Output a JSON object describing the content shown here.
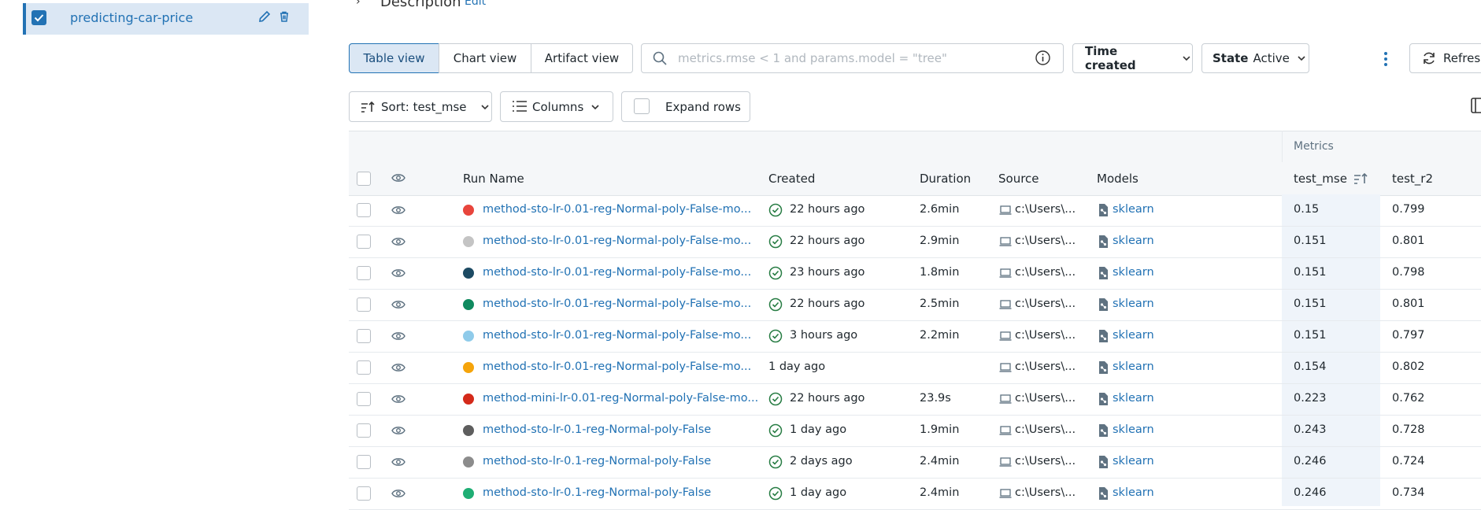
{
  "sidebar": {
    "experiment_name": "predicting-car-price"
  },
  "description": {
    "title": "Description",
    "edit_label": "Edit"
  },
  "view_tabs": [
    "Table view",
    "Chart view",
    "Artifact view"
  ],
  "search": {
    "placeholder": "metrics.rmse < 1 and params.model = \"tree\""
  },
  "time_filter": {
    "label": "Time created"
  },
  "state_filter": {
    "label": "State",
    "value": "Active"
  },
  "refresh_label": "Refresh",
  "sort_label": "Sort: test_mse",
  "columns_label": "Columns",
  "expand_rows_label": "Expand rows",
  "table": {
    "group_header": "Metrics",
    "headers": {
      "run_name": "Run Name",
      "created": "Created",
      "duration": "Duration",
      "source": "Source",
      "models": "Models",
      "metric1": "test_mse",
      "metric2": "test_r2"
    },
    "rows": [
      {
        "color": "#e8453c",
        "run_name": "method-sto-lr-0.01-reg-Normal-poly-False-mo...",
        "status": "finished",
        "created": "22 hours ago",
        "duration": "2.6min",
        "source": "c:\\Users\\...",
        "model": "sklearn",
        "test_mse": "0.15",
        "test_r2": "0.799"
      },
      {
        "color": "#c4c4c4",
        "run_name": "method-sto-lr-0.01-reg-Normal-poly-False-mo...",
        "status": "finished",
        "created": "22 hours ago",
        "duration": "2.9min",
        "source": "c:\\Users\\...",
        "model": "sklearn",
        "test_mse": "0.151",
        "test_r2": "0.801"
      },
      {
        "color": "#1c4a63",
        "run_name": "method-sto-lr-0.01-reg-Normal-poly-False-mo...",
        "status": "finished",
        "created": "23 hours ago",
        "duration": "1.8min",
        "source": "c:\\Users\\...",
        "model": "sklearn",
        "test_mse": "0.151",
        "test_r2": "0.798"
      },
      {
        "color": "#0f8a5f",
        "run_name": "method-sto-lr-0.01-reg-Normal-poly-False-mo...",
        "status": "finished",
        "created": "22 hours ago",
        "duration": "2.5min",
        "source": "c:\\Users\\...",
        "model": "sklearn",
        "test_mse": "0.151",
        "test_r2": "0.801"
      },
      {
        "color": "#8fcbea",
        "run_name": "method-sto-lr-0.01-reg-Normal-poly-False-mo...",
        "status": "finished",
        "created": "3 hours ago",
        "duration": "2.2min",
        "source": "c:\\Users\\...",
        "model": "sklearn",
        "test_mse": "0.151",
        "test_r2": "0.797"
      },
      {
        "color": "#f5a40b",
        "run_name": "method-sto-lr-0.01-reg-Normal-poly-False-mo...",
        "status": "none",
        "created": "1 day ago",
        "duration": "",
        "source": "c:\\Users\\...",
        "model": "sklearn",
        "test_mse": "0.154",
        "test_r2": "0.802"
      },
      {
        "color": "#d42a1a",
        "run_name": "method-mini-lr-0.01-reg-Normal-poly-False-mo...",
        "status": "finished",
        "created": "22 hours ago",
        "duration": "23.9s",
        "source": "c:\\Users\\...",
        "model": "sklearn",
        "test_mse": "0.223",
        "test_r2": "0.762"
      },
      {
        "color": "#5e5e5e",
        "run_name": "method-sto-lr-0.1-reg-Normal-poly-False",
        "status": "finished",
        "created": "1 day ago",
        "duration": "1.9min",
        "source": "c:\\Users\\...",
        "model": "sklearn",
        "test_mse": "0.243",
        "test_r2": "0.728"
      },
      {
        "color": "#8c8c8c",
        "run_name": "method-sto-lr-0.1-reg-Normal-poly-False",
        "status": "finished",
        "created": "2 days ago",
        "duration": "2.4min",
        "source": "c:\\Users\\...",
        "model": "sklearn",
        "test_mse": "0.246",
        "test_r2": "0.724"
      },
      {
        "color": "#1fae74",
        "run_name": "method-sto-lr-0.1-reg-Normal-poly-False",
        "status": "finished",
        "created": "1 day ago",
        "duration": "2.4min",
        "source": "c:\\Users\\...",
        "model": "sklearn",
        "test_mse": "0.246",
        "test_r2": "0.734"
      }
    ]
  }
}
